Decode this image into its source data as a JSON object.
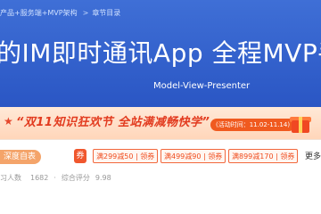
{
  "breadcrumb": {
    "link1": "产品+服务端+MVP架构",
    "separator": ">",
    "current": "章节目录"
  },
  "course": {
    "title": "的IM即时通讯App 全程MVP手把",
    "subtitle": "Model-View-Presenter"
  },
  "promo": {
    "star": "★",
    "text": "“双11知识狂欢节  全站满减畅快学”",
    "period": "(活动时间：11.02-11.14)"
  },
  "info": {
    "tag": "深度自表",
    "coupon_icon": "券",
    "coupons": [
      "满299减50 | 领券",
      "满499减90 | 领券",
      "满899减170 | 领券"
    ],
    "more": "更多",
    "learners_label": "习人数",
    "learners_value": "1682",
    "dot": "·",
    "score_label": "综合评分",
    "score_value": "9.98"
  },
  "colors": {
    "banner": "#2a56c4",
    "promo_bg": "#ffd6ba",
    "accent": "#ef4b1c",
    "tag": "#f4a46a"
  }
}
